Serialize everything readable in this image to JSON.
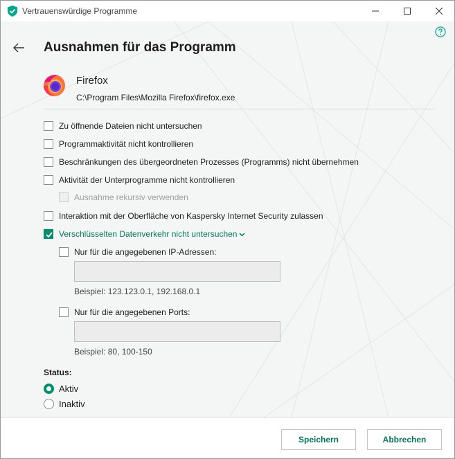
{
  "window": {
    "title": "Vertrauenswürdige Programme"
  },
  "page": {
    "title": "Ausnahmen für das Programm"
  },
  "program": {
    "name": "Firefox",
    "path": "C:\\Program Files\\Mozilla Firefox\\firefox.exe"
  },
  "options": [
    {
      "label": "Zu öffnende Dateien nicht untersuchen",
      "checked": false,
      "disabled": false
    },
    {
      "label": "Programmaktivität nicht kontrollieren",
      "checked": false,
      "disabled": false
    },
    {
      "label": "Beschränkungen des übergeordneten Prozesses (Programms) nicht übernehmen",
      "checked": false,
      "disabled": false
    },
    {
      "label": "Aktivität der Unterprogramme nicht kontrollieren",
      "checked": false,
      "disabled": false
    },
    {
      "label": "Ausnahme rekursiv verwenden",
      "checked": false,
      "disabled": true
    },
    {
      "label": "Interaktion mit der Oberfläche von Kaspersky Internet Security zulassen",
      "checked": false,
      "disabled": false
    },
    {
      "label": "Verschlüsselten Datenverkehr nicht untersuchen",
      "checked": true,
      "disabled": false
    }
  ],
  "encrypted": {
    "ip": {
      "label": "Nur für die angegebenen IP-Adressen:",
      "value": "",
      "hint": "Beispiel: 123.123.0.1, 192.168.0.1"
    },
    "ports": {
      "label": "Nur für die angegebenen Ports:",
      "value": "",
      "hint": "Beispiel: 80, 100-150"
    }
  },
  "status": {
    "label": "Status:",
    "options": [
      "Aktiv",
      "Inaktiv"
    ],
    "selected": "Aktiv"
  },
  "buttons": {
    "save": "Speichern",
    "cancel": "Abbrechen"
  },
  "colors": {
    "accent": "#008f6b",
    "accent_text": "#00795a",
    "background": "#f4f5f5"
  }
}
